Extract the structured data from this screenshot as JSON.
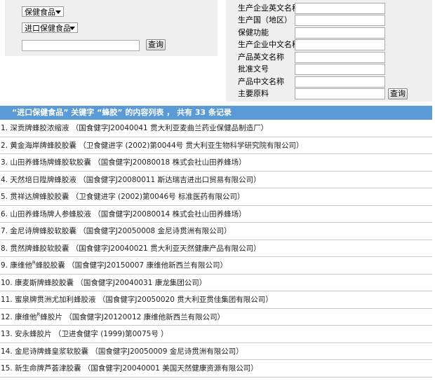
{
  "filters": {
    "category_select": "保健食品",
    "subcategory_select": "进口保健食品",
    "keyword_value": "",
    "query_button": "查询"
  },
  "advanced_search": {
    "fields": [
      {
        "label": "生产企业英文名称",
        "value": ""
      },
      {
        "label": "生产国（地区）",
        "value": ""
      },
      {
        "label": "保健功能",
        "value": ""
      },
      {
        "label": "生产企业中文名称",
        "value": ""
      },
      {
        "label": "产品英文名称",
        "value": ""
      },
      {
        "label": "批准文号",
        "value": ""
      },
      {
        "label": "产品中文名称",
        "value": ""
      },
      {
        "label": "主要原料",
        "value": ""
      }
    ],
    "query_button": "查询"
  },
  "results": {
    "header": "“进口保健食品” 关键字 “蜂胶” 的内容列表 ， 共有 33 条记录",
    "items": [
      {
        "text": "1. 深贡牌蜂胶浓缩液  （国食健字J20040041  贯大利亚麦曲兰药业保健品制造厂）"
      },
      {
        "text": "2. 黄金海岸牌蜂胶胶囊  （卫食健进字 (2002)第0044号  贯大利亚生物科学研究院有限公司）"
      },
      {
        "text": "3. 山田养蜂场牌蜂胶软胶囊  （国食健字J20080018  株式会社山田养蜂场）"
      },
      {
        "text": "4. 天然培日陞牌蜂胶液  （国食健字J20080011  斯达瑞吉进出口贸易有限公司）"
      },
      {
        "text": "5. 贯祥达牌蜂胶胶囊  （卫食健进字 (2002)第0046号  标准医药有限公司）"
      },
      {
        "text": "6. 山田养蜂场牌人参蜂胶液  （国食健字J20080014  株式会社山田养蜂场）"
      },
      {
        "text": "7. 金尼诗牌蜂胶软胶囊  （国食健字J20050008  金尼诗贯洲有限公司）"
      },
      {
        "text": "8. 贯然牌蜂胶软胶囊  （国食健字J20040021  贯大利亚天然健康产品有限公司）"
      },
      {
        "text": "9. 康维他",
        "sup": "R",
        "rest": "蜂胶胶囊  （国食健字J20150007  康维他新西兰有限公司）"
      },
      {
        "text": "10. 康麦斯牌蜂胶胶囊  （国食健字J20040031  康龙集团公司）"
      },
      {
        "text": "11. 蜜泉牌贯洲尤加利蜂胶液  （国食健字J20050020  贯大利亚贯佳集团有限公司）"
      },
      {
        "text": "12. 康维他",
        "sup": "R",
        "rest": "蜂胶片  （国食健字J20120012  康维他新西兰有限公司）"
      },
      {
        "text": "13. 安永蜂胶片  （卫进食健字 (1999)第0075号 ）"
      },
      {
        "text": "14. 金尼诗牌蜂皇浆软胶囊  （国食健字J20050009  金尼诗贯洲有限公司）"
      },
      {
        "text": "15. 新生命牌芦荟津胶囊  （国食健字J20040001  美国天然健康资源有限公司）"
      }
    ]
  }
}
